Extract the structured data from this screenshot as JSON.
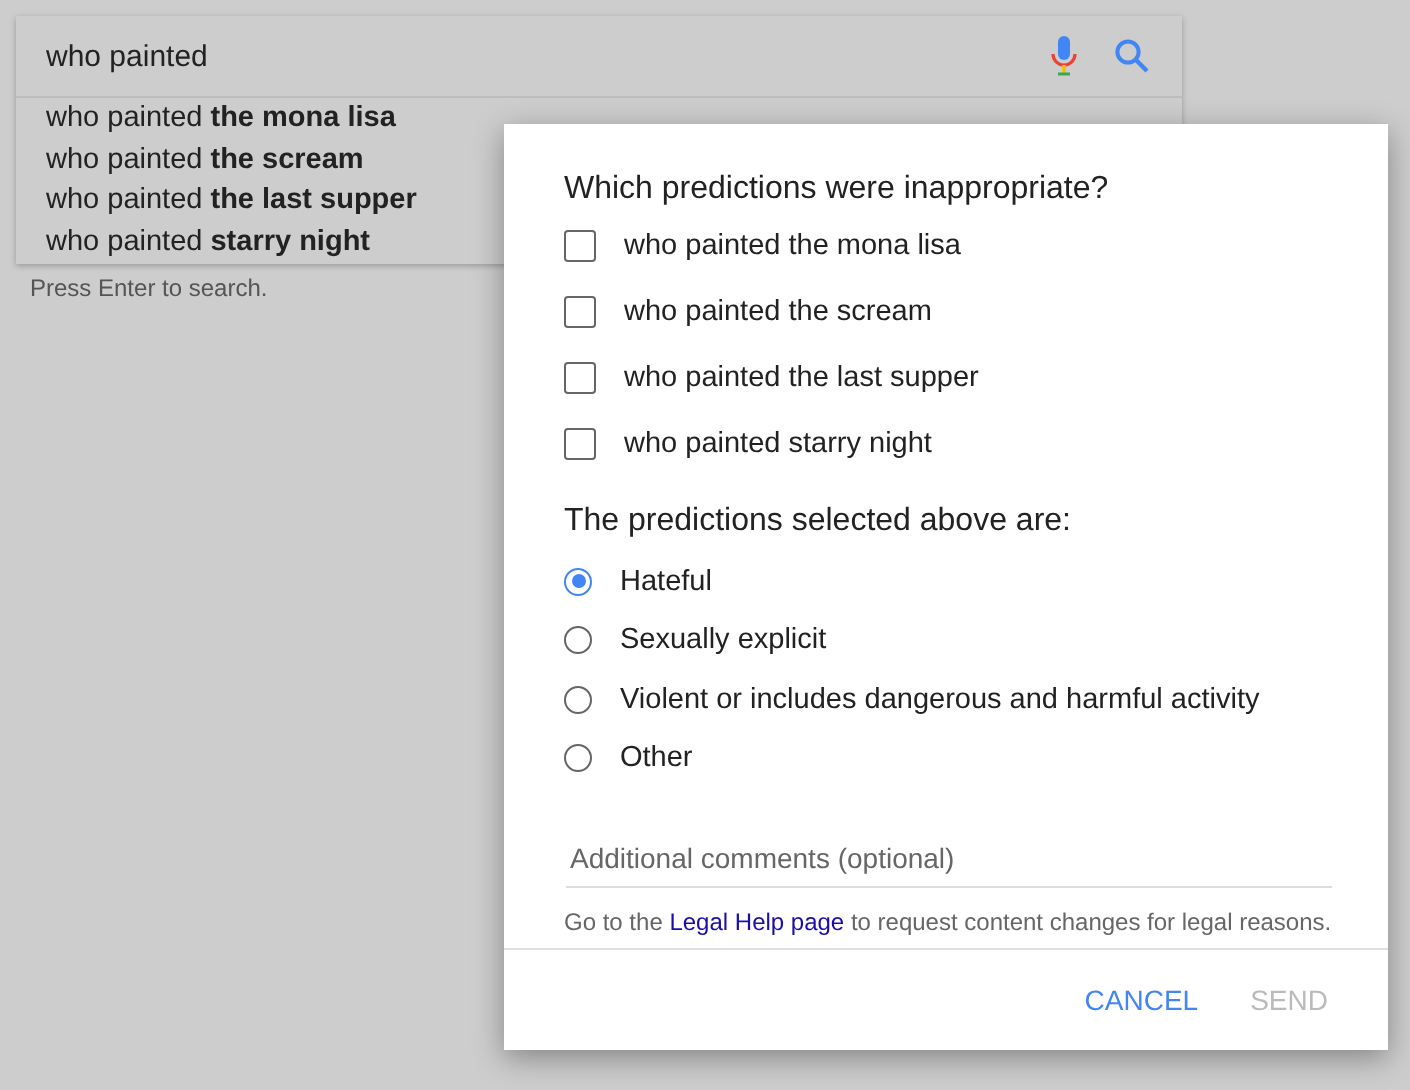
{
  "search": {
    "value": "who painted"
  },
  "suggestions": [
    "who painted **the mona lisa**",
    "who painted **the scream**",
    "who painted **the last supper**",
    "who painted **starry night**"
  ],
  "hint": "Press Enter to search.",
  "dialog": {
    "question": "Which predictions were inappropriate?",
    "predictions": [
      {
        "label": "who painted the mona lisa",
        "checked": false
      },
      {
        "label": "who painted the scream",
        "checked": false
      },
      {
        "label": "who painted the last supper",
        "checked": false
      },
      {
        "label": "who painted starry night",
        "checked": false
      }
    ],
    "reason_heading": "The predictions selected above are:",
    "reasons": [
      {
        "label": "Hateful",
        "selected": true
      },
      {
        "label": "Sexually explicit",
        "selected": false
      },
      {
        "label": "Violent or includes dangerous and harmful activity",
        "selected": false
      },
      {
        "label": "Other",
        "selected": false
      }
    ],
    "comments": {
      "placeholder": "Additional comments (optional)"
    },
    "legal": {
      "before": "Go to the ",
      "link": "Legal Help page",
      "after": " to request content changes for legal reasons."
    },
    "buttons": [
      {
        "label": "CANCEL",
        "disabled": false
      },
      {
        "label": "SEND",
        "disabled": true
      }
    ]
  }
}
